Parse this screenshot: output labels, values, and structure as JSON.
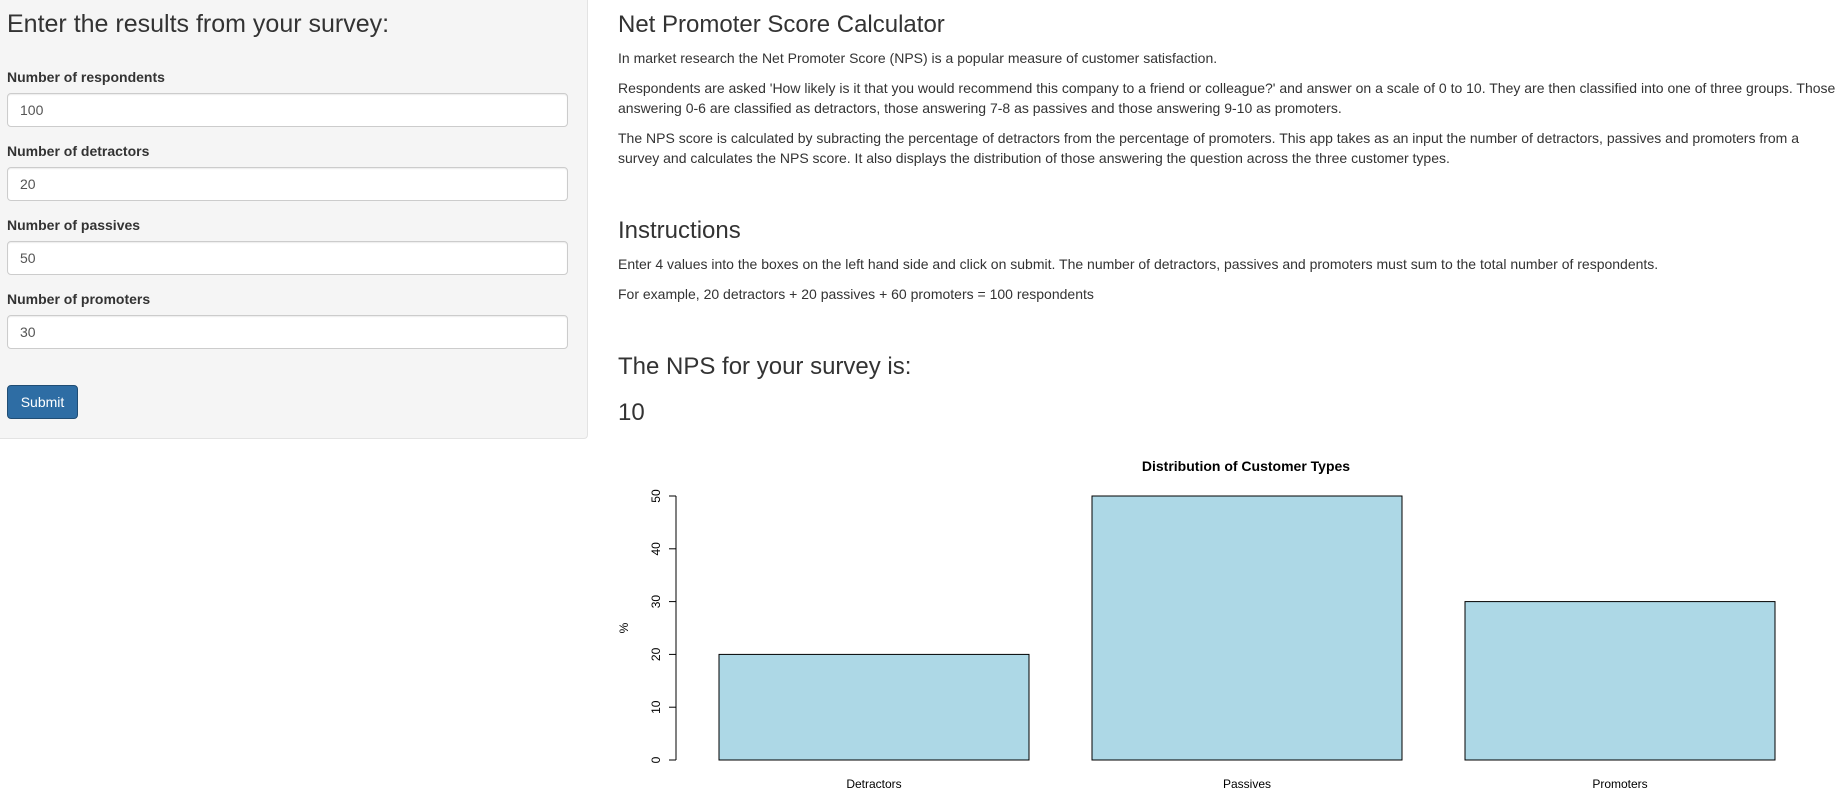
{
  "sidebar": {
    "title": "Enter the results from your survey:",
    "fields": [
      {
        "label": "Number of respondents",
        "value": "100"
      },
      {
        "label": "Number of detractors",
        "value": "20"
      },
      {
        "label": "Number of passives",
        "value": "50"
      },
      {
        "label": "Number of promoters",
        "value": "30"
      }
    ],
    "submit_label": "Submit"
  },
  "main": {
    "title": "Net Promoter Score Calculator",
    "intro": [
      "In market research the Net Promoter Score (NPS) is a popular measure of customer satisfaction.",
      "Respondents are asked 'How likely is it that you would recommend this company to a friend or colleague?' and answer on a scale of 0 to 10. They are then classified into one of three groups. Those answering 0-6 are classified as detractors, those answering 7-8 as passives and those answering 9-10 as promoters.",
      "The NPS score is calculated by subracting the percentage of detractors from the percentage of promoters. This app takes as an input the number of detractors, passives and promoters from a survey and calculates the NPS score. It also displays the distribution of those answering the question across the three customer types."
    ],
    "instructions_title": "Instructions",
    "instructions": [
      "Enter 4 values into the boxes on the left hand side and click on submit. The number of detractors, passives and promoters must sum to the total number of respondents.",
      "For example, 20 detractors + 20 passives + 60 promoters = 100 respondents"
    ],
    "result_title": "The NPS for your survey is:",
    "result_value": "10"
  },
  "colors": {
    "bar_fill": "#add8e6",
    "button": "#2e6da4",
    "sidebar_bg": "#f5f5f5"
  },
  "chart_data": {
    "type": "bar",
    "title": "Distribution of Customer Types",
    "xlabel": "",
    "ylabel": "%",
    "categories": [
      "Detractors",
      "Passives",
      "Promoters"
    ],
    "values": [
      20,
      50,
      30
    ],
    "ylim": [
      0,
      50
    ],
    "yticks": [
      0,
      10,
      20,
      30,
      40,
      50
    ],
    "grid": false,
    "legend": "none"
  }
}
